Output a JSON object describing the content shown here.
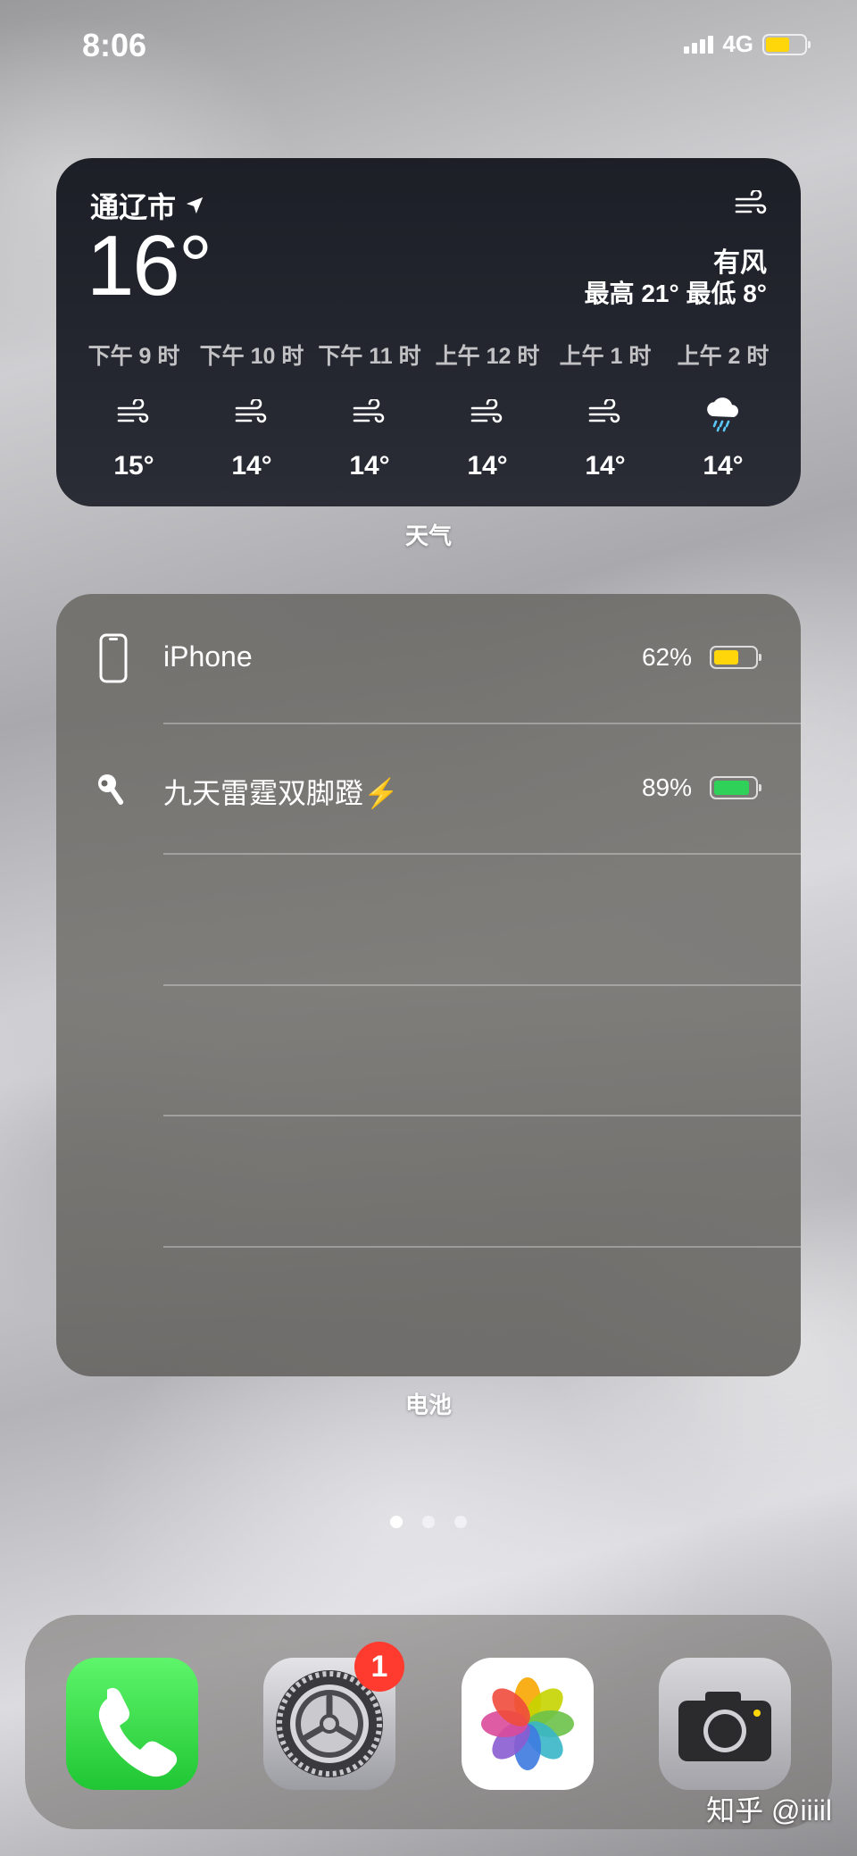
{
  "status_bar": {
    "time": "8:06",
    "network": "4G",
    "battery_level": 0.62,
    "battery_color": "#ffd60a"
  },
  "weather": {
    "city": "通辽市",
    "location_icon": "location-arrow-icon",
    "temperature": "16°",
    "condition_icon": "wind-icon",
    "condition": "有风",
    "high_low": "最高 21° 最低 8°",
    "hourly": [
      {
        "time": "下午 9 时",
        "icon": "wind-icon",
        "temp": "15°"
      },
      {
        "time": "下午 10 时",
        "icon": "wind-icon",
        "temp": "14°"
      },
      {
        "time": "下午 11 时",
        "icon": "wind-icon",
        "temp": "14°"
      },
      {
        "time": "上午 12 时",
        "icon": "wind-icon",
        "temp": "14°"
      },
      {
        "time": "上午 1 时",
        "icon": "wind-icon",
        "temp": "14°"
      },
      {
        "time": "上午 2 时",
        "icon": "rain-cloud-icon",
        "temp": "14°"
      }
    ],
    "label": "天气"
  },
  "batteries": {
    "devices": [
      {
        "name": "iPhone",
        "icon": "iphone-icon",
        "percent": "62%",
        "level": 0.62,
        "color": "#ffd60a"
      },
      {
        "name": "九天雷霆双脚蹬⚡️",
        "icon": "airpod-icon",
        "percent": "89%",
        "level": 0.89,
        "color": "#30d158"
      }
    ],
    "label": "电池"
  },
  "page_indicator": {
    "count": 3,
    "active": 0
  },
  "dock": {
    "apps": [
      {
        "name": "Phone",
        "icon": "phone-icon"
      },
      {
        "name": "Settings",
        "icon": "settings-gear-icon",
        "badge": "1"
      },
      {
        "name": "Photos",
        "icon": "photos-flower-icon"
      },
      {
        "name": "Camera",
        "icon": "camera-icon"
      }
    ]
  },
  "watermark": "知乎 @iiiil"
}
